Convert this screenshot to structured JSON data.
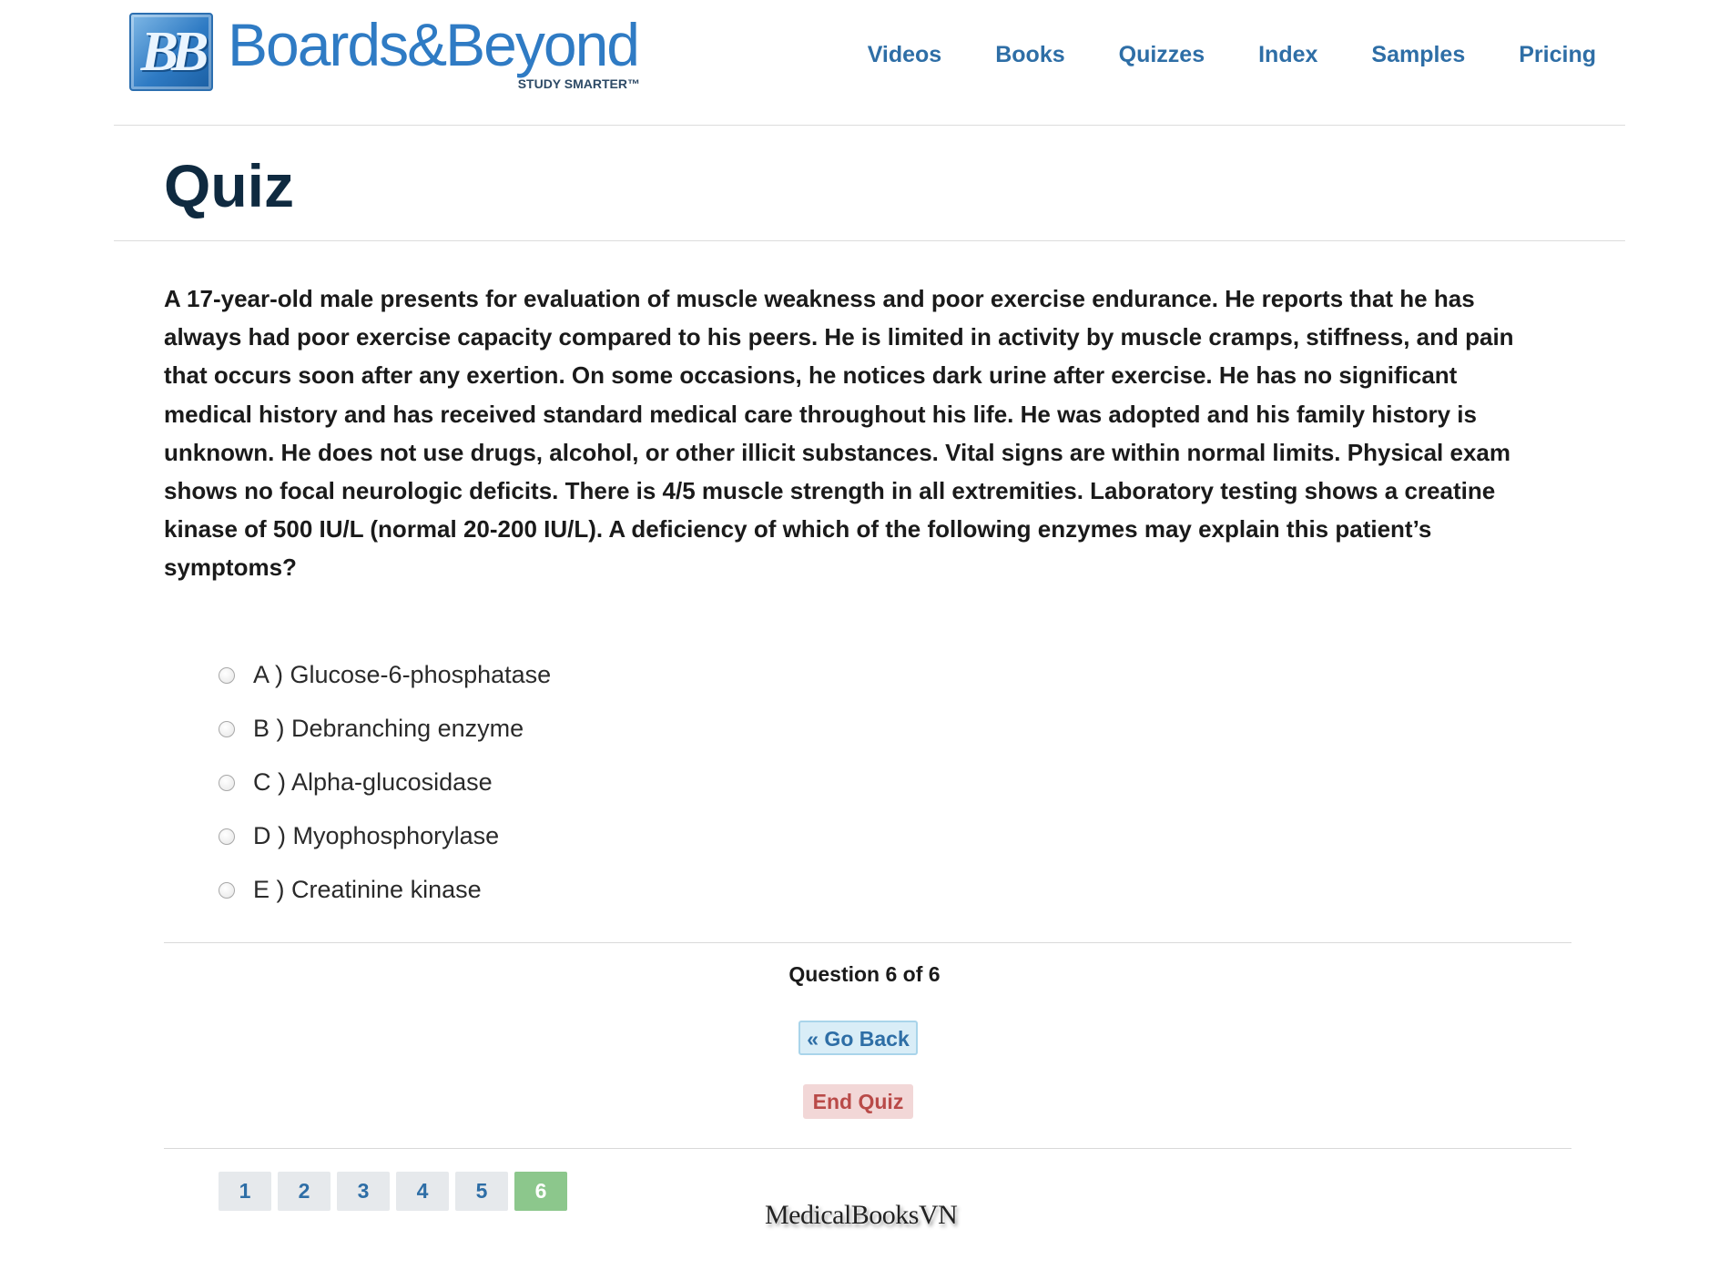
{
  "header": {
    "logo_badge": "BB",
    "logo_name": "Boards&Beyond",
    "logo_tagline": "STUDY SMARTER™",
    "nav": [
      "Videos",
      "Books",
      "Quizzes",
      "Index",
      "Samples",
      "Pricing"
    ]
  },
  "page_title": "Quiz",
  "question": {
    "text": "A 17-year-old male presents for evaluation of muscle weakness and poor exercise endurance. He reports that he has always had poor exercise capacity compared to his peers. He is limited in activity by muscle cramps, stiffness, and pain that occurs soon after any exertion. On some occasions, he notices dark urine after exercise. He has no significant medical history and has received standard medical care throughout his life. He was adopted and his family history is unknown. He does not use drugs, alcohol, or other illicit substances. Vital signs are within normal limits. Physical exam shows no focal neurologic deficits. There is 4/5 muscle strength in all extremities. Laboratory testing shows a creatine kinase of 500 IU/L (normal 20-200 IU/L). A deficiency of which of the following enzymes may explain this patient’s symptoms?",
    "options": [
      "A ) Glucose-6-phosphatase",
      "B ) Debranching enzyme",
      "C ) Alpha-glucosidase",
      "D ) Myophosphorylase",
      "E ) Creatinine kinase"
    ]
  },
  "progress": "Question 6 of 6",
  "buttons": {
    "go_back": "« Go Back",
    "end_quiz": "End Quiz"
  },
  "pager": {
    "pages": [
      "1",
      "2",
      "3",
      "4",
      "5",
      "6"
    ],
    "active": "6"
  },
  "watermark": "MedicalBooksVN",
  "colors": {
    "nav": "#2e6ea6",
    "active_page": "#8cc78c",
    "end_quiz": "#b94a48",
    "go_back_bg": "#d9edf7"
  }
}
